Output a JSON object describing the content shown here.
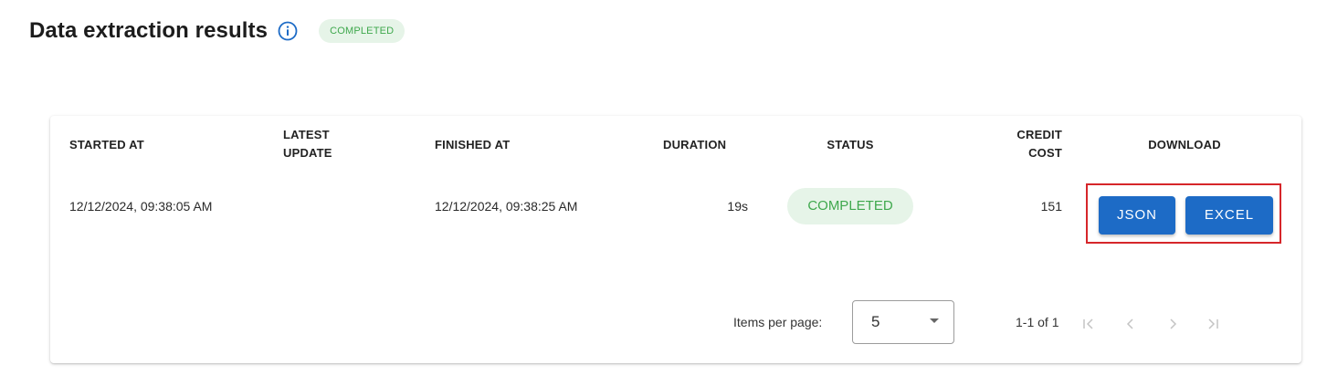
{
  "header": {
    "title": "Data extraction results",
    "info_icon": "info-circle-icon",
    "status_badge": "COMPLETED"
  },
  "table": {
    "columns": {
      "started_at": "STARTED AT",
      "latest_update_line1": "LATEST",
      "latest_update_line2": "UPDATE",
      "finished_at": "FINISHED AT",
      "duration": "DURATION",
      "status": "STATUS",
      "credit_cost_line1": "CREDIT",
      "credit_cost_line2": "COST",
      "download": "DOWNLOAD"
    },
    "rows": [
      {
        "started_at": "12/12/2024, 09:38:05 AM",
        "latest_update": "",
        "finished_at": "12/12/2024, 09:38:25 AM",
        "duration": "19s",
        "status": "COMPLETED",
        "credit_cost": "151",
        "download_json": "JSON",
        "download_excel": "EXCEL"
      }
    ]
  },
  "paginator": {
    "items_per_page_label": "Items per page:",
    "items_per_page_value": "5",
    "range_label": "1-1 of 1",
    "icons": [
      "first-page-icon",
      "previous-page-icon",
      "next-page-icon",
      "last-page-icon"
    ]
  },
  "colors": {
    "accent": "#1d6bc6",
    "status_green": "#3fa84d",
    "status_bg": "#e6f4e8",
    "highlight_red": "#d6262a"
  }
}
